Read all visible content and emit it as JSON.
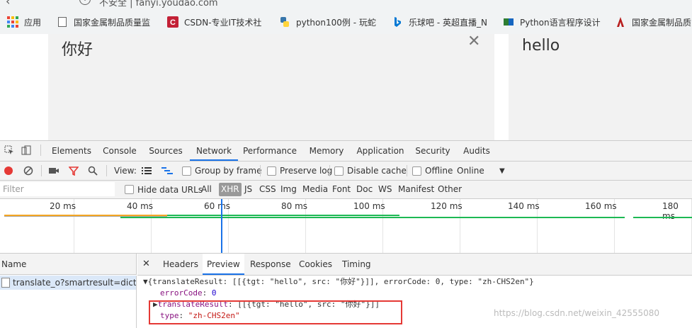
{
  "browser": {
    "url_partial": "不安全 | fanyi.youdao.com",
    "bookmarks": [
      {
        "label": "应用",
        "icon": "apps-grid-icon"
      },
      {
        "label": "国家金属制品质量监",
        "icon": "document-icon"
      },
      {
        "label": "CSDN-专业IT技术社",
        "icon": "csdn-icon"
      },
      {
        "label": "python100例 - 玩蛇",
        "icon": "python-icon"
      },
      {
        "label": "乐球吧 - 英超直播_N",
        "icon": "bing-icon"
      },
      {
        "label": "Python语言程序设计",
        "icon": "mooc-icon"
      },
      {
        "label": "国家金属制品质",
        "icon": "steel-icon"
      }
    ]
  },
  "translator": {
    "source_text": "你好",
    "target_text": "hello",
    "close_glyph": "✕"
  },
  "devtools": {
    "tabs": [
      "Elements",
      "Console",
      "Sources",
      "Network",
      "Performance",
      "Memory",
      "Application",
      "Security",
      "Audits"
    ],
    "active_tab": "Network",
    "toolbar": {
      "view_label": "View:",
      "group_by_frame": "Group by frame",
      "preserve_log": "Preserve log",
      "disable_cache": "Disable cache",
      "offline": "Offline",
      "throttle": "Online"
    },
    "filter": {
      "placeholder": "Filter",
      "hide_data_urls": "Hide data URLs",
      "types": [
        "All",
        "XHR",
        "JS",
        "CSS",
        "Img",
        "Media",
        "Font",
        "Doc",
        "WS",
        "Manifest",
        "Other"
      ],
      "selected_type": "XHR"
    },
    "timeline_ticks": [
      "20 ms",
      "40 ms",
      "60 ms",
      "80 ms",
      "100 ms",
      "120 ms",
      "140 ms",
      "160 ms",
      "180 ms"
    ],
    "requests": {
      "name_header": "Name",
      "rows": [
        "translate_o?smartresult=dict&..."
      ]
    },
    "detail_tabs": [
      "Headers",
      "Preview",
      "Response",
      "Cookies",
      "Timing"
    ],
    "active_detail_tab": "Preview",
    "preview": {
      "summary": "{translateResult: [[{tgt: \"hello\", src: \"你好\"}]], errorCode: 0, type: \"zh-CHS2en\"}",
      "error_key": "errorCode",
      "error_value": "0",
      "result_key": "translateResult",
      "result_value": "[[{tgt: \"hello\", src: \"你好\"}]]",
      "type_key": "type",
      "type_value": "\"zh-CHS2en\""
    }
  },
  "watermark": "https://blog.csdn.net/weixin_42555080",
  "colors": {
    "accent": "#1a73e8",
    "record": "#e53935",
    "highlight_box": "#e53935",
    "xhr_selected": "#999999"
  }
}
